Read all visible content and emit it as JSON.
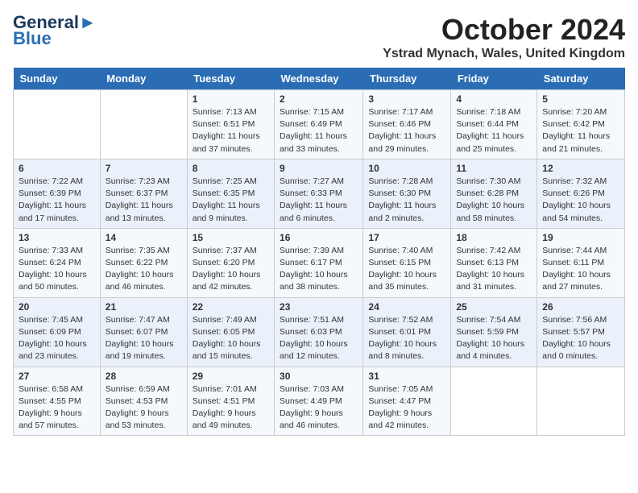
{
  "header": {
    "logo_line1": "General",
    "logo_line2": "Blue",
    "month": "October 2024",
    "location": "Ystrad Mynach, Wales, United Kingdom"
  },
  "weekdays": [
    "Sunday",
    "Monday",
    "Tuesday",
    "Wednesday",
    "Thursday",
    "Friday",
    "Saturday"
  ],
  "weeks": [
    [
      {
        "day": "",
        "content": ""
      },
      {
        "day": "",
        "content": ""
      },
      {
        "day": "1",
        "content": "Sunrise: 7:13 AM\nSunset: 6:51 PM\nDaylight: 11 hours and 37 minutes."
      },
      {
        "day": "2",
        "content": "Sunrise: 7:15 AM\nSunset: 6:49 PM\nDaylight: 11 hours and 33 minutes."
      },
      {
        "day": "3",
        "content": "Sunrise: 7:17 AM\nSunset: 6:46 PM\nDaylight: 11 hours and 29 minutes."
      },
      {
        "day": "4",
        "content": "Sunrise: 7:18 AM\nSunset: 6:44 PM\nDaylight: 11 hours and 25 minutes."
      },
      {
        "day": "5",
        "content": "Sunrise: 7:20 AM\nSunset: 6:42 PM\nDaylight: 11 hours and 21 minutes."
      }
    ],
    [
      {
        "day": "6",
        "content": "Sunrise: 7:22 AM\nSunset: 6:39 PM\nDaylight: 11 hours and 17 minutes."
      },
      {
        "day": "7",
        "content": "Sunrise: 7:23 AM\nSunset: 6:37 PM\nDaylight: 11 hours and 13 minutes."
      },
      {
        "day": "8",
        "content": "Sunrise: 7:25 AM\nSunset: 6:35 PM\nDaylight: 11 hours and 9 minutes."
      },
      {
        "day": "9",
        "content": "Sunrise: 7:27 AM\nSunset: 6:33 PM\nDaylight: 11 hours and 6 minutes."
      },
      {
        "day": "10",
        "content": "Sunrise: 7:28 AM\nSunset: 6:30 PM\nDaylight: 11 hours and 2 minutes."
      },
      {
        "day": "11",
        "content": "Sunrise: 7:30 AM\nSunset: 6:28 PM\nDaylight: 10 hours and 58 minutes."
      },
      {
        "day": "12",
        "content": "Sunrise: 7:32 AM\nSunset: 6:26 PM\nDaylight: 10 hours and 54 minutes."
      }
    ],
    [
      {
        "day": "13",
        "content": "Sunrise: 7:33 AM\nSunset: 6:24 PM\nDaylight: 10 hours and 50 minutes."
      },
      {
        "day": "14",
        "content": "Sunrise: 7:35 AM\nSunset: 6:22 PM\nDaylight: 10 hours and 46 minutes."
      },
      {
        "day": "15",
        "content": "Sunrise: 7:37 AM\nSunset: 6:20 PM\nDaylight: 10 hours and 42 minutes."
      },
      {
        "day": "16",
        "content": "Sunrise: 7:39 AM\nSunset: 6:17 PM\nDaylight: 10 hours and 38 minutes."
      },
      {
        "day": "17",
        "content": "Sunrise: 7:40 AM\nSunset: 6:15 PM\nDaylight: 10 hours and 35 minutes."
      },
      {
        "day": "18",
        "content": "Sunrise: 7:42 AM\nSunset: 6:13 PM\nDaylight: 10 hours and 31 minutes."
      },
      {
        "day": "19",
        "content": "Sunrise: 7:44 AM\nSunset: 6:11 PM\nDaylight: 10 hours and 27 minutes."
      }
    ],
    [
      {
        "day": "20",
        "content": "Sunrise: 7:45 AM\nSunset: 6:09 PM\nDaylight: 10 hours and 23 minutes."
      },
      {
        "day": "21",
        "content": "Sunrise: 7:47 AM\nSunset: 6:07 PM\nDaylight: 10 hours and 19 minutes."
      },
      {
        "day": "22",
        "content": "Sunrise: 7:49 AM\nSunset: 6:05 PM\nDaylight: 10 hours and 15 minutes."
      },
      {
        "day": "23",
        "content": "Sunrise: 7:51 AM\nSunset: 6:03 PM\nDaylight: 10 hours and 12 minutes."
      },
      {
        "day": "24",
        "content": "Sunrise: 7:52 AM\nSunset: 6:01 PM\nDaylight: 10 hours and 8 minutes."
      },
      {
        "day": "25",
        "content": "Sunrise: 7:54 AM\nSunset: 5:59 PM\nDaylight: 10 hours and 4 minutes."
      },
      {
        "day": "26",
        "content": "Sunrise: 7:56 AM\nSunset: 5:57 PM\nDaylight: 10 hours and 0 minutes."
      }
    ],
    [
      {
        "day": "27",
        "content": "Sunrise: 6:58 AM\nSunset: 4:55 PM\nDaylight: 9 hours and 57 minutes."
      },
      {
        "day": "28",
        "content": "Sunrise: 6:59 AM\nSunset: 4:53 PM\nDaylight: 9 hours and 53 minutes."
      },
      {
        "day": "29",
        "content": "Sunrise: 7:01 AM\nSunset: 4:51 PM\nDaylight: 9 hours and 49 minutes."
      },
      {
        "day": "30",
        "content": "Sunrise: 7:03 AM\nSunset: 4:49 PM\nDaylight: 9 hours and 46 minutes."
      },
      {
        "day": "31",
        "content": "Sunrise: 7:05 AM\nSunset: 4:47 PM\nDaylight: 9 hours and 42 minutes."
      },
      {
        "day": "",
        "content": ""
      },
      {
        "day": "",
        "content": ""
      }
    ]
  ]
}
